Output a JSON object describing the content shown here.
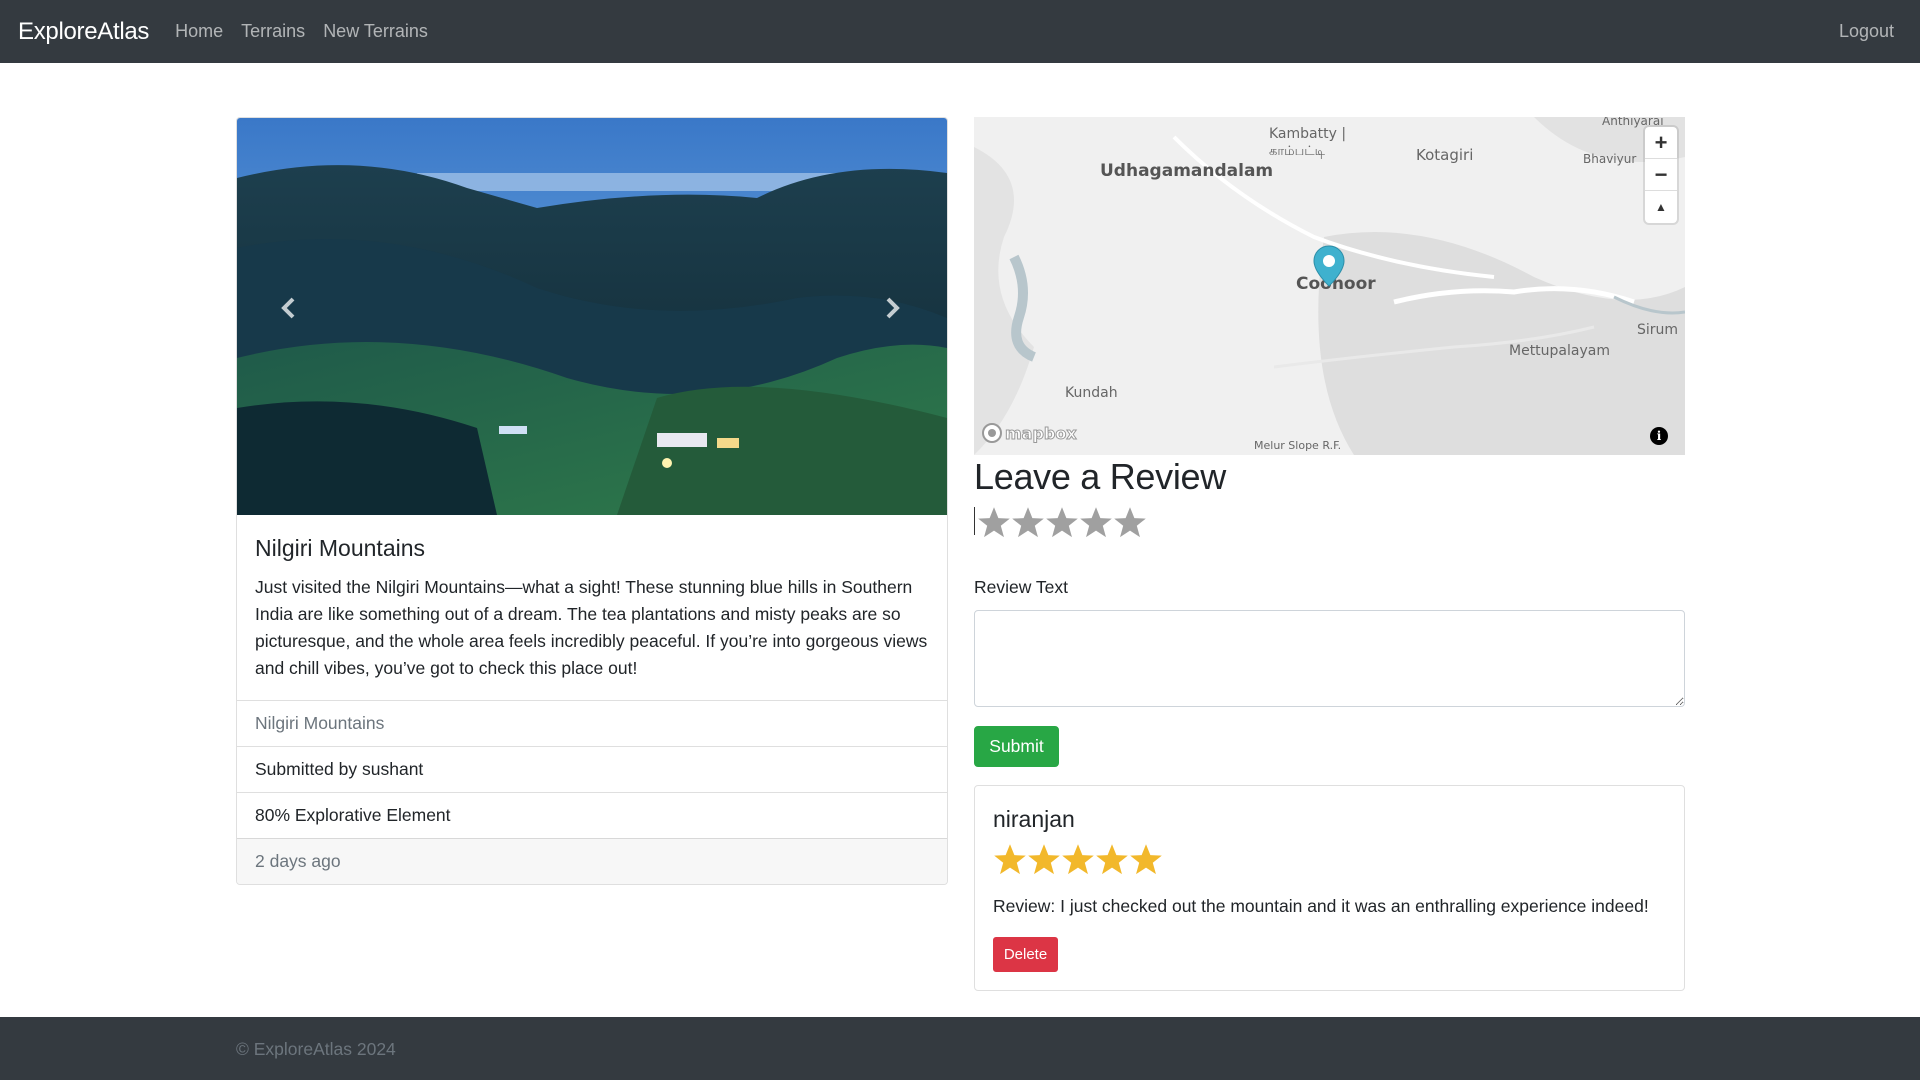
{
  "navbar": {
    "brand": "ExploreAtlas",
    "links": [
      "Home",
      "Terrains",
      "New Terrains"
    ],
    "logout": "Logout"
  },
  "terrain": {
    "title": "Nilgiri Mountains",
    "description": "Just visited the Nilgiri Mountains—what a sight! These stunning blue hills in Southern India are like something out of a dream. The tea plantations and misty peaks are so picturesque, and the whole area feels incredibly peaceful. If you’re into gorgeous views and chill vibes, you’ve got to check this place out!",
    "location": "Nilgiri Mountains",
    "submitted_by": "Submitted by sushant",
    "explorative": "80% Explorative Element",
    "posted": "2 days ago"
  },
  "map": {
    "labels": {
      "udhagamandalam": "Udhagamandalam",
      "kambatty": "Kambatty |",
      "kambatty_tamil": "காம்பட்டி",
      "kotagiri": "Kotagiri",
      "anthiyur": "Anthiyarai",
      "bhaviyur": "Bhaviyur",
      "coonoor": "Coonoor",
      "mettupalayam": "Mettupalayam",
      "sirumugai": "Sirum",
      "kundah": "Kundah",
      "melur": "Melur Slope R.F.",
      "mapbox": "mapbox"
    },
    "zoom_in": "+",
    "zoom_out": "−",
    "compass": "▲",
    "info": "i",
    "marker_color": "#3fb1ce"
  },
  "review_form": {
    "heading": "Leave a Review",
    "rating_value": 0,
    "rating_max": 5,
    "label": "Review Text",
    "text_value": "",
    "submit": "Submit"
  },
  "reviews": [
    {
      "author": "niranjan",
      "rating": 5,
      "body": "Review: I just checked out the mountain and it was an enthralling experience indeed!",
      "delete": "Delete"
    }
  ],
  "footer": {
    "text": "© ExploreAtlas 2024"
  },
  "colors": {
    "navbar": "#343a40",
    "submit": "#28a745",
    "delete": "#dc3545",
    "star_filled": "#f2b82b",
    "star_empty": "#a0a0a0"
  }
}
